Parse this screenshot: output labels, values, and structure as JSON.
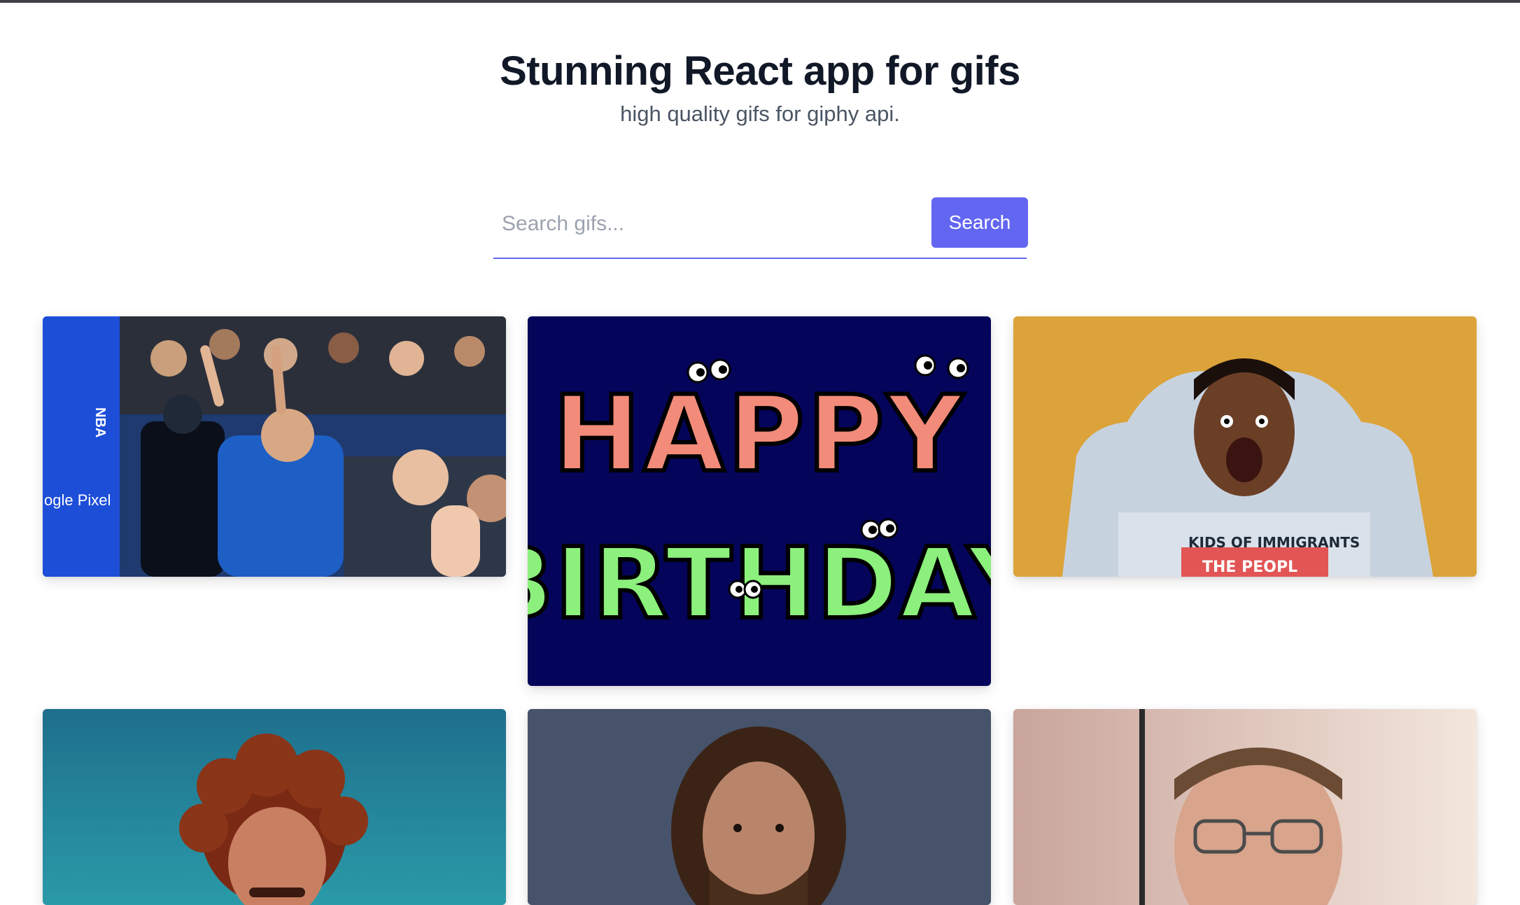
{
  "header": {
    "title": "Stunning React app for gifs",
    "subtitle": "high quality gifs for giphy api."
  },
  "search": {
    "placeholder": "Search gifs...",
    "value": "",
    "button_label": "Search"
  },
  "gifs": [
    {
      "name": "basketball-crowd-gif",
      "caption_text": "ogle Pixel",
      "court_text": "NBA"
    },
    {
      "name": "happy-birthday-gif",
      "line1": "HAPPY",
      "line2": "BIRTHDAY"
    },
    {
      "name": "shocked-man-gif",
      "shirt_text_1": "KIDS OF IMMIGRANTS",
      "shirt_text_2": "THE PEOPL"
    },
    {
      "name": "curly-hair-man-gif"
    },
    {
      "name": "long-hair-man-gif"
    },
    {
      "name": "glasses-man-gif"
    }
  ],
  "colors": {
    "accent": "#6366f1",
    "title": "#111827",
    "subtitle": "#4b5563"
  }
}
